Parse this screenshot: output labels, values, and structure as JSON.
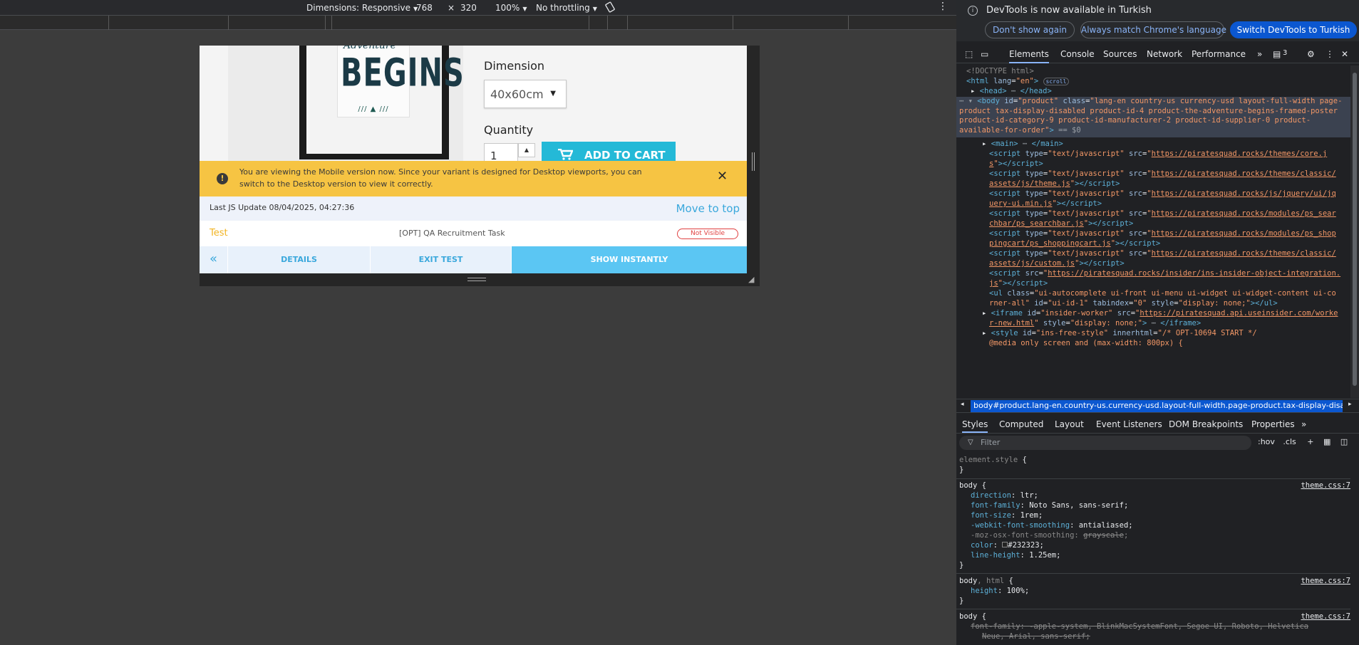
{
  "toolbar": {
    "dimensions_label": "Dimensions: Responsive",
    "width": "768",
    "times": "×",
    "height": "320",
    "zoom": "100%",
    "throttling": "No throttling"
  },
  "page": {
    "poster_script": "Adventure",
    "poster_title": "BEGINS",
    "dimension_label": "Dimension",
    "dimension_value": "40x60cm",
    "quantity_label": "Quantity",
    "quantity_value": "1",
    "add_to_cart": "ADD TO CART"
  },
  "alert": {
    "message": "You are viewing the Mobile version now. Since your variant is designed for Desktop viewports, you can switch to the Desktop version to view it correctly.",
    "close": "✕"
  },
  "qa_panel": {
    "last_update": "Last JS Update 08/04/2025, 04:27:36",
    "move_to_top": "Move to top",
    "test_label": "Test",
    "task_name": "[OPT] QA Recruitment Task",
    "status_badge": "Not Visible",
    "back": "«",
    "details": "DETAILS",
    "exit_test": "EXIT TEST",
    "show_instantly": "SHOW INSTANTLY"
  },
  "devtools": {
    "banner_title": "DevTools is now available in Turkish",
    "dont_show": "Don't show again",
    "match_language": "Always match Chrome's language",
    "switch_turkish": "Switch DevTools to Turkish",
    "tabs": [
      "Elements",
      "Console",
      "Sources",
      "Network",
      "Performance"
    ],
    "issues_count": "3",
    "breadcrumb": "body#product.lang-en.country-us.currency-usd.layout-full-width.page-product.tax-display-disab",
    "style_tabs": [
      "Styles",
      "Computed",
      "Layout",
      "Event Listeners",
      "DOM Breakpoints",
      "Properties"
    ],
    "filter_placeholder": "Filter",
    "hov": ":hov",
    "cls": ".cls"
  },
  "colors": {
    "accent": "#24b9d7",
    "alert": "#f6c443",
    "link": "#3aa8dc",
    "badge": "#e04040",
    "devtools_blue": "#0b57d0"
  }
}
